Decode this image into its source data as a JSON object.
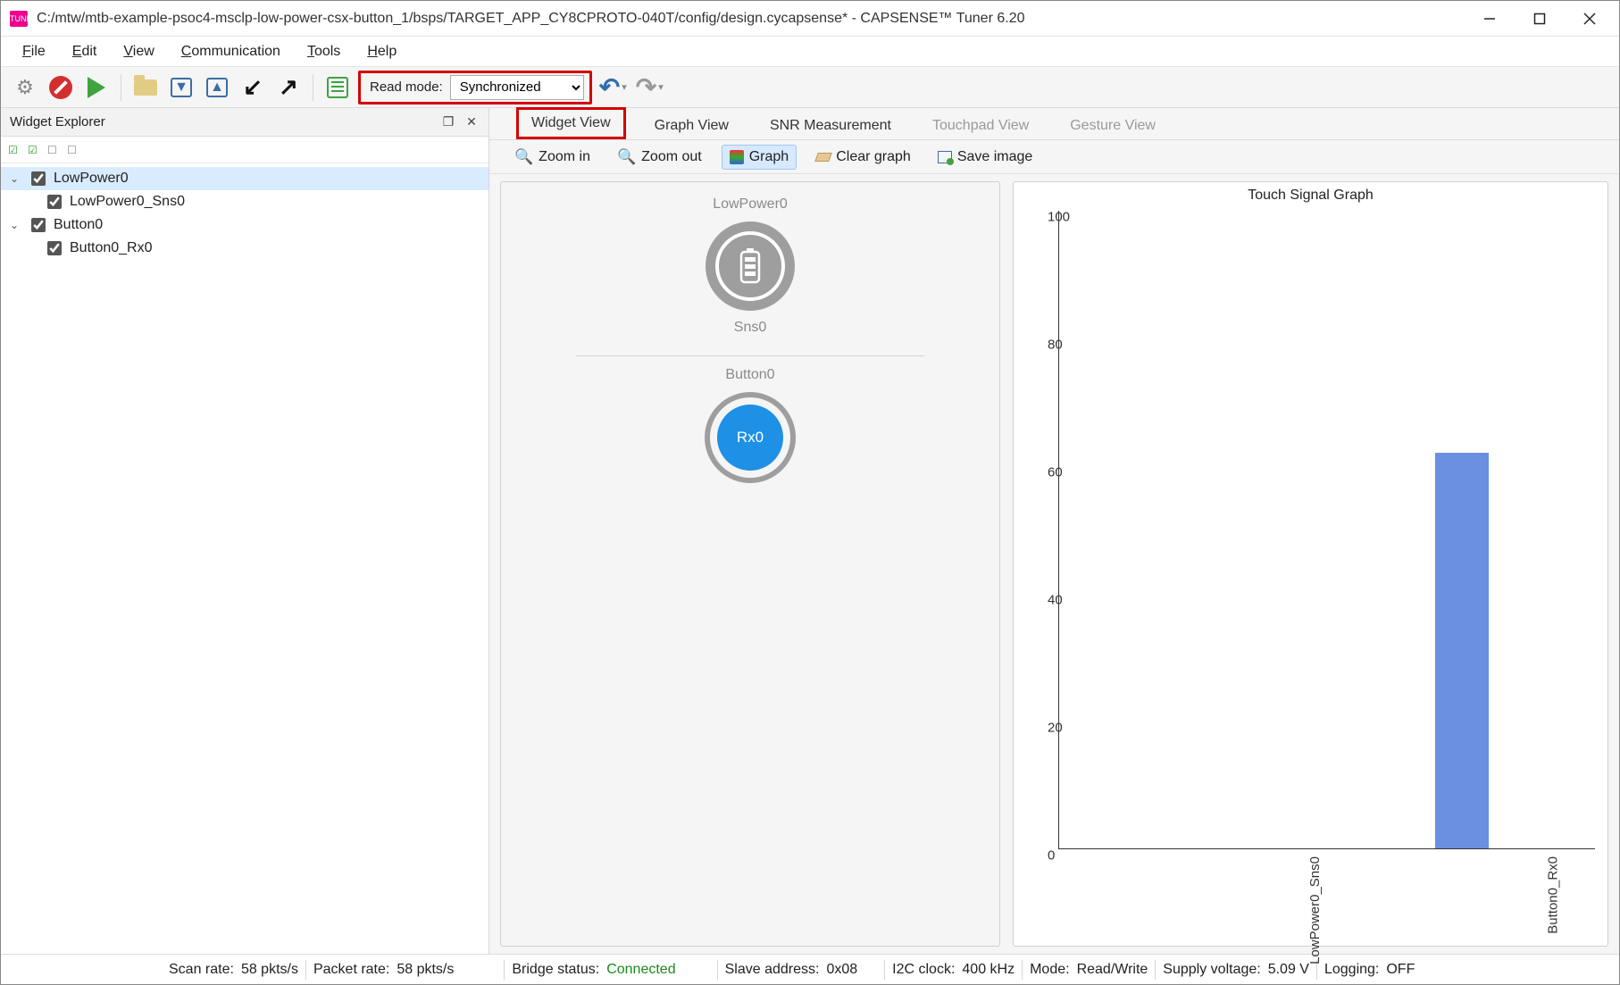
{
  "window": {
    "title": "C:/mtw/mtb-example-psoc4-msclp-low-power-csx-button_1/bsps/TARGET_APP_CY8CPROTO-040T/config/design.cycapsense* - CAPSENSE™ Tuner 6.20"
  },
  "menu": {
    "file": "File",
    "edit": "Edit",
    "view": "View",
    "communication": "Communication",
    "tools": "Tools",
    "help": "Help"
  },
  "toolbar": {
    "read_mode_label": "Read mode:",
    "read_mode_value": "Synchronized"
  },
  "explorer": {
    "title": "Widget Explorer",
    "items": [
      {
        "label": "LowPower0",
        "children": [
          {
            "label": "LowPower0_Sns0"
          }
        ]
      },
      {
        "label": "Button0",
        "children": [
          {
            "label": "Button0_Rx0"
          }
        ]
      }
    ]
  },
  "tabs": {
    "widget_view": "Widget View",
    "graph_view": "Graph View",
    "snr": "SNR Measurement",
    "touchpad": "Touchpad View",
    "gesture": "Gesture View"
  },
  "subtoolbar": {
    "zoom_in": "Zoom in",
    "zoom_out": "Zoom out",
    "graph": "Graph",
    "clear": "Clear graph",
    "save": "Save image"
  },
  "widget_view": {
    "group1_title": "LowPower0",
    "group1_sensor": "Sns0",
    "group2_title": "Button0",
    "group2_sensor": "Rx0"
  },
  "chart": {
    "title": "Touch Signal Graph"
  },
  "chart_data": {
    "type": "bar",
    "title": "Touch Signal Graph",
    "categories": [
      "LowPower0_Sns0",
      "Button0_Rx0"
    ],
    "values": [
      0,
      62
    ],
    "ylabel": "",
    "xlabel": "",
    "ylim": [
      0,
      100
    ],
    "yticks": [
      0,
      20,
      40,
      60,
      80,
      100
    ]
  },
  "status": {
    "scan_rate_label": "Scan rate:",
    "scan_rate_value": "58 pkts/s",
    "packet_rate_label": "Packet rate:",
    "packet_rate_value": "58 pkts/s",
    "bridge_status_label": "Bridge status:",
    "bridge_status_value": "Connected",
    "slave_addr_label": "Slave address:",
    "slave_addr_value": "0x08",
    "i2c_label": "I2C clock:",
    "i2c_value": "400 kHz",
    "mode_label": "Mode:",
    "mode_value": "Read/Write",
    "supply_label": "Supply voltage:",
    "supply_value": "5.09 V",
    "logging_label": "Logging:",
    "logging_value": "OFF"
  }
}
